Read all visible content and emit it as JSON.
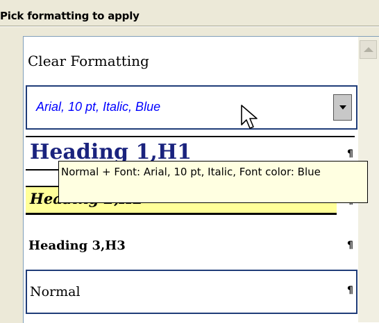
{
  "panel": {
    "title": "Pick formatting to apply"
  },
  "styles_list": {
    "items": [
      {
        "label": "Clear Formatting"
      },
      {
        "label": "Arial, 10 pt, Italic, Blue",
        "selected": true
      },
      {
        "label": "Heading 1,H1",
        "mark": "¶"
      },
      {
        "label": "Heading 2,H2",
        "mark": "¶"
      },
      {
        "label": "Heading 3,H3",
        "mark": "¶"
      },
      {
        "label": "Normal",
        "mark": "¶"
      }
    ]
  },
  "tooltip": {
    "text": "Normal + Font: Arial, 10 pt, Italic, Font color: Blue"
  },
  "colors": {
    "selection_border": "#1f3c78",
    "italic_blue": "#0000ff",
    "heading1": "#1a237e",
    "heading2_bg": "#ffff99",
    "tooltip_bg": "#ffffe1"
  },
  "icons": {
    "dropdown": "chevron-down-icon",
    "scroll_up": "arrow-up-icon",
    "cursor": "mouse-pointer-icon",
    "pilcrow": "paragraph-mark-icon"
  }
}
